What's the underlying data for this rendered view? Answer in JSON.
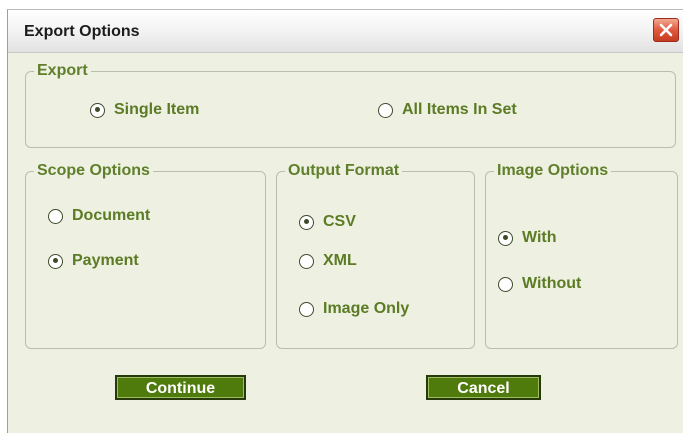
{
  "dialog": {
    "title": "Export Options",
    "close_icon": "close-icon"
  },
  "export_group": {
    "legend": "Export",
    "options": [
      {
        "label": "Single Item",
        "checked": true
      },
      {
        "label": "All Items In Set",
        "checked": false
      }
    ]
  },
  "scope_group": {
    "legend": "Scope Options",
    "options": [
      {
        "label": "Document",
        "checked": false
      },
      {
        "label": "Payment",
        "checked": true
      }
    ]
  },
  "format_group": {
    "legend": "Output Format",
    "options": [
      {
        "label": "CSV",
        "checked": true
      },
      {
        "label": "XML",
        "checked": false
      },
      {
        "label": "Image Only",
        "checked": false
      }
    ]
  },
  "image_group": {
    "legend": "Image Options",
    "options": [
      {
        "label": "With",
        "checked": true
      },
      {
        "label": "Without",
        "checked": false
      }
    ]
  },
  "buttons": {
    "continue_label": "Continue",
    "cancel_label": "Cancel"
  },
  "colors": {
    "accent": "#5b7b24",
    "button_bg": "#4f7b0c",
    "close_bg": "#e0593e",
    "dialog_bg": "#eef0e2"
  }
}
